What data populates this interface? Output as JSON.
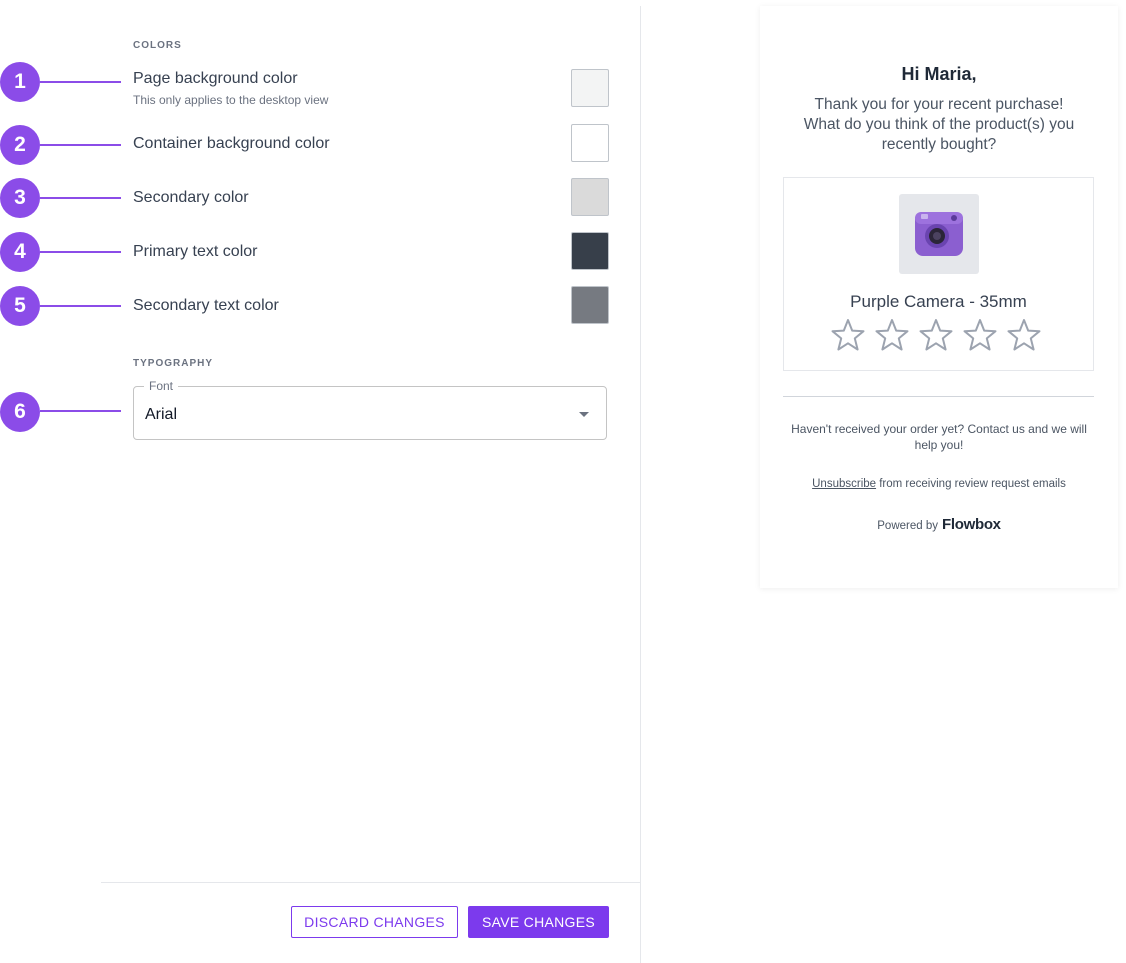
{
  "colors_section": {
    "title": "COLORS",
    "rows": [
      {
        "marker": "1",
        "label": "Page background color",
        "help": "This only applies to the desktop view",
        "swatch": "#f3f4f4"
      },
      {
        "marker": "2",
        "label": "Container background color",
        "swatch": "#ffffff"
      },
      {
        "marker": "3",
        "label": "Secondary color",
        "swatch": "#dadada"
      },
      {
        "marker": "4",
        "label": "Primary text color",
        "swatch": "#373f4a"
      },
      {
        "marker": "5",
        "label": "Secondary text color",
        "swatch": "#767a81"
      }
    ]
  },
  "typography_section": {
    "title": "TYPOGRAPHY",
    "marker": "6",
    "font_label": "Font",
    "font_value": "Arial"
  },
  "footer": {
    "discard_label": "DISCARD CHANGES",
    "save_label": "SAVE CHANGES"
  },
  "preview": {
    "greeting": "Hi Maria,",
    "intro": "Thank you for your recent purchase!\nWhat do you think of the product(s) you recently bought?",
    "product_name": "Purple Camera - 35mm",
    "rating_stars": 5,
    "notice": "Haven't received your order yet? Contact us and we will help you!",
    "unsubscribe_link": "Unsubscribe",
    "unsubscribe_text": " from receiving review request emails",
    "powered_by": "Powered by",
    "brand": "Flowbox"
  },
  "theme": {
    "accent": "#7c3aed",
    "marker_color": "#8b4ce8"
  }
}
